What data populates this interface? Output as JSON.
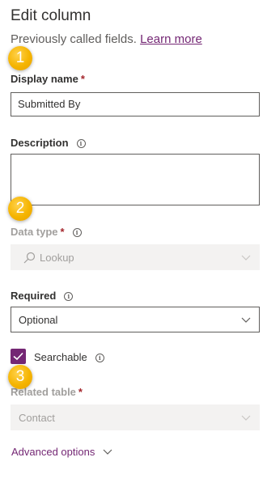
{
  "panel": {
    "title": "Edit column",
    "subtitle_text": "Previously called fields.",
    "learn_more_link": "Learn more"
  },
  "fields": {
    "display_name": {
      "label": "Display name",
      "required_mark": "*",
      "value": "Submitted By"
    },
    "description": {
      "label": "Description",
      "info_icon": "info-icon",
      "value": ""
    },
    "data_type": {
      "label": "Data type",
      "required_mark": "*",
      "info_icon": "info-icon",
      "value": "Lookup",
      "value_icon": "search-icon"
    },
    "required": {
      "label": "Required",
      "info_icon": "info-icon",
      "value": "Optional"
    },
    "searchable": {
      "label": "Searchable",
      "checked": true,
      "info_icon": "info-icon"
    },
    "related_table": {
      "label": "Related table",
      "required_mark": "*",
      "value": "Contact"
    }
  },
  "advanced_options": {
    "label": "Advanced options"
  },
  "callouts": [
    "1",
    "2",
    "3"
  ],
  "colors": {
    "accent": "#742774",
    "required": "#a4262c",
    "callout": "#f5b400"
  }
}
